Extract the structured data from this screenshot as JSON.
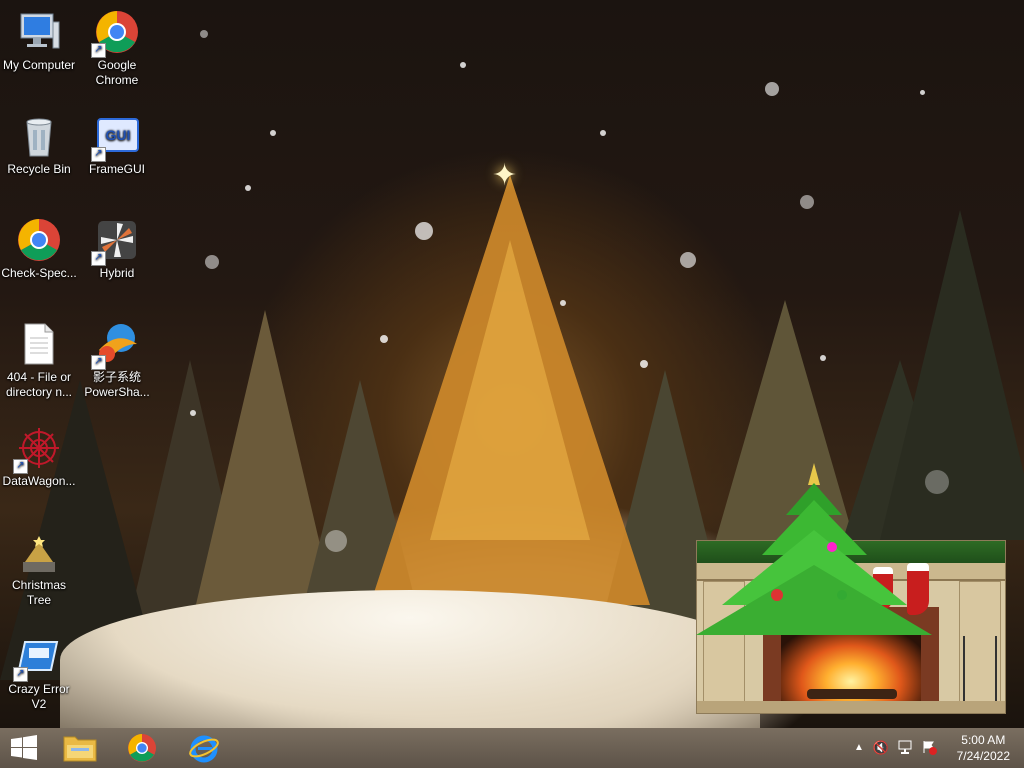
{
  "desktop_icons": [
    {
      "label": "My Computer",
      "icon": "computer-icon"
    },
    {
      "label": "Google\nChrome",
      "icon": "chrome-icon"
    },
    {
      "label": "Recycle Bin",
      "icon": "recycle-bin-icon"
    },
    {
      "label": "FrameGUI",
      "icon": "framegui-icon"
    },
    {
      "label": "Check-Spec...",
      "icon": "chrome-icon"
    },
    {
      "label": "Hybrid",
      "icon": "hybrid-icon"
    },
    {
      "label": "404 - File or\ndirectory n...",
      "icon": "document-icon"
    },
    {
      "label": "影子系统\nPowerSha...",
      "icon": "powershadow-icon"
    },
    {
      "label": "DataWagon...",
      "icon": "datawagon-icon"
    },
    {
      "label": "Christmas\nTree",
      "icon": "christmas-tree-icon"
    },
    {
      "label": "Crazy Error V2",
      "icon": "crazy-error-icon"
    }
  ],
  "framegui_badge": "GUI",
  "taskbar": {
    "pinned": [
      "start-button",
      "file-explorer",
      "chrome",
      "internet-explorer"
    ],
    "clock": {
      "time": "5:00 AM",
      "date": "7/24/2022"
    },
    "tray": [
      "show-hidden-icons",
      "volume-muted",
      "network",
      "action-center"
    ]
  },
  "colors": {
    "taskbar": "#6b6054",
    "accent_chrome_red": "#db4437",
    "accent_ie": "#1e90ff"
  }
}
